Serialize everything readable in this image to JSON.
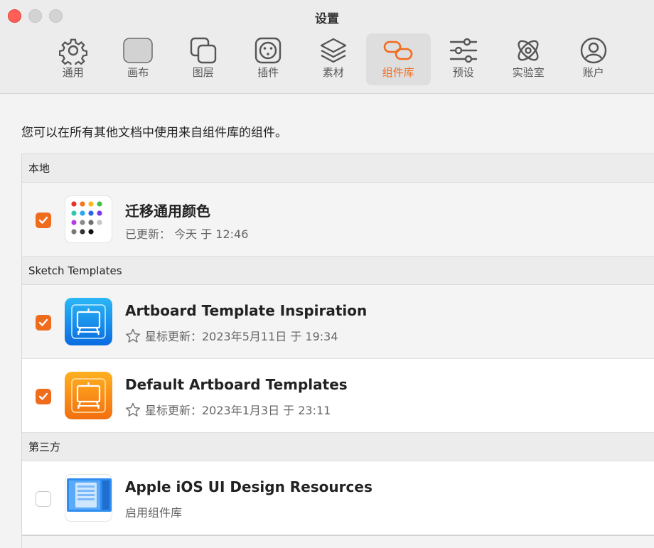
{
  "window": {
    "title": "设置"
  },
  "tabs": [
    {
      "label": "通用",
      "icon": "gear-icon"
    },
    {
      "label": "画布",
      "icon": "canvas-icon"
    },
    {
      "label": "图层",
      "icon": "layers-square-icon"
    },
    {
      "label": "插件",
      "icon": "plugin-icon"
    },
    {
      "label": "素材",
      "icon": "stack-icon"
    },
    {
      "label": "组件库",
      "icon": "link-icon",
      "active": true
    },
    {
      "label": "预设",
      "icon": "sliders-icon"
    },
    {
      "label": "实验室",
      "icon": "atom-icon"
    },
    {
      "label": "账户",
      "icon": "person-icon"
    }
  ],
  "description": "您可以在所有其他文档中使用来自组件库的组件。",
  "sections": [
    {
      "header": "本地",
      "items": [
        {
          "title": "迁移通用颜色",
          "subtitle": "已更新： 今天 于 12:46",
          "checked": true
        }
      ]
    },
    {
      "header": "Sketch Templates",
      "items": [
        {
          "title": "Artboard Template Inspiration",
          "subtitle": "星标更新：2023年5月11日 于 19:34",
          "checked": true
        },
        {
          "title": "Default Artboard Templates",
          "subtitle": "星标更新：2023年1月3日 于 23:11",
          "checked": true
        }
      ]
    },
    {
      "header": "第三方",
      "items": [
        {
          "title": "Apple iOS UI Design Resources",
          "subtitle": "启用组件库",
          "checked": false
        }
      ]
    }
  ],
  "colors": {
    "accent": "#f26b1d",
    "checkbox": "#f06c1d"
  }
}
